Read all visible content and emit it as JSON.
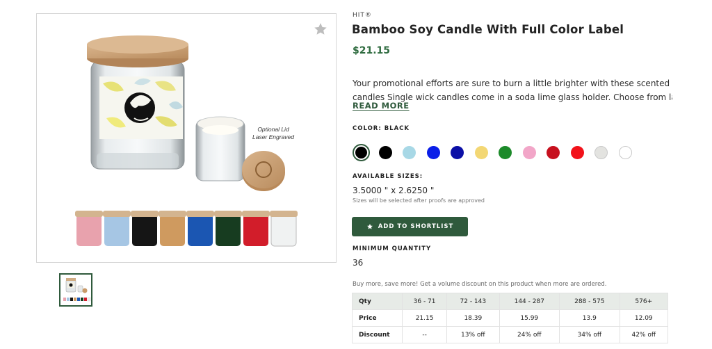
{
  "product": {
    "brand": "HIT®",
    "title": "Bamboo Soy Candle With Full Color Label",
    "price": "$21.15",
    "description_lines": [
      "Your promotional efforts are sure to burn a little brighter with these scented soy",
      "candles Single wick candles come in a soda lime glass holder. Choose from lavende..."
    ],
    "read_more": "READ MORE"
  },
  "image": {
    "caption_line1": "Optional Lid",
    "caption_line2": "Laser Engraved",
    "icons": {
      "favorite": "star-icon"
    }
  },
  "colors": {
    "label": "COLOR: BLACK",
    "swatches": [
      {
        "name": "Black",
        "hex": "#000000",
        "selected": true
      },
      {
        "name": "Black",
        "hex": "#000000"
      },
      {
        "name": "Light Blue",
        "hex": "#a8d8e6"
      },
      {
        "name": "Blue",
        "hex": "#0a1ee8"
      },
      {
        "name": "Navy",
        "hex": "#0b0fa6"
      },
      {
        "name": "Yellow",
        "hex": "#f3d774"
      },
      {
        "name": "Green",
        "hex": "#1c8a2a"
      },
      {
        "name": "Pink",
        "hex": "#f2a6c8"
      },
      {
        "name": "Dark Red",
        "hex": "#c7101e"
      },
      {
        "name": "Red",
        "hex": "#f2121a"
      },
      {
        "name": "Light Gray",
        "hex": "#e3e3e0"
      },
      {
        "name": "White",
        "hex": "#ffffff"
      }
    ]
  },
  "sizes": {
    "label": "AVAILABLE SIZES:",
    "value": "3.5000 \" x 2.6250 \"",
    "note": "Sizes will be selected after proofs are approved"
  },
  "shortlist": {
    "label": "ADD TO SHORTLIST",
    "icon": "star-icon"
  },
  "minimum_quantity": {
    "label": "MINIMUM QUANTITY",
    "value": "36"
  },
  "pricing": {
    "note": "Buy more, save more! Get a volume discount on this product when more are ordered.",
    "headers": [
      "Qty",
      "36 - 71",
      "72 - 143",
      "144 - 287",
      "288 - 575",
      "576+"
    ],
    "price_row": [
      "Price",
      "21.15",
      "18.39",
      "15.99",
      "13.9",
      "12.09"
    ],
    "discount_row": [
      "Discount",
      "--",
      "13% off",
      "24% off",
      "34% off",
      "42% off"
    ]
  },
  "theme": {
    "accent": "#2f5a3c",
    "price": "#2e6b3f"
  }
}
